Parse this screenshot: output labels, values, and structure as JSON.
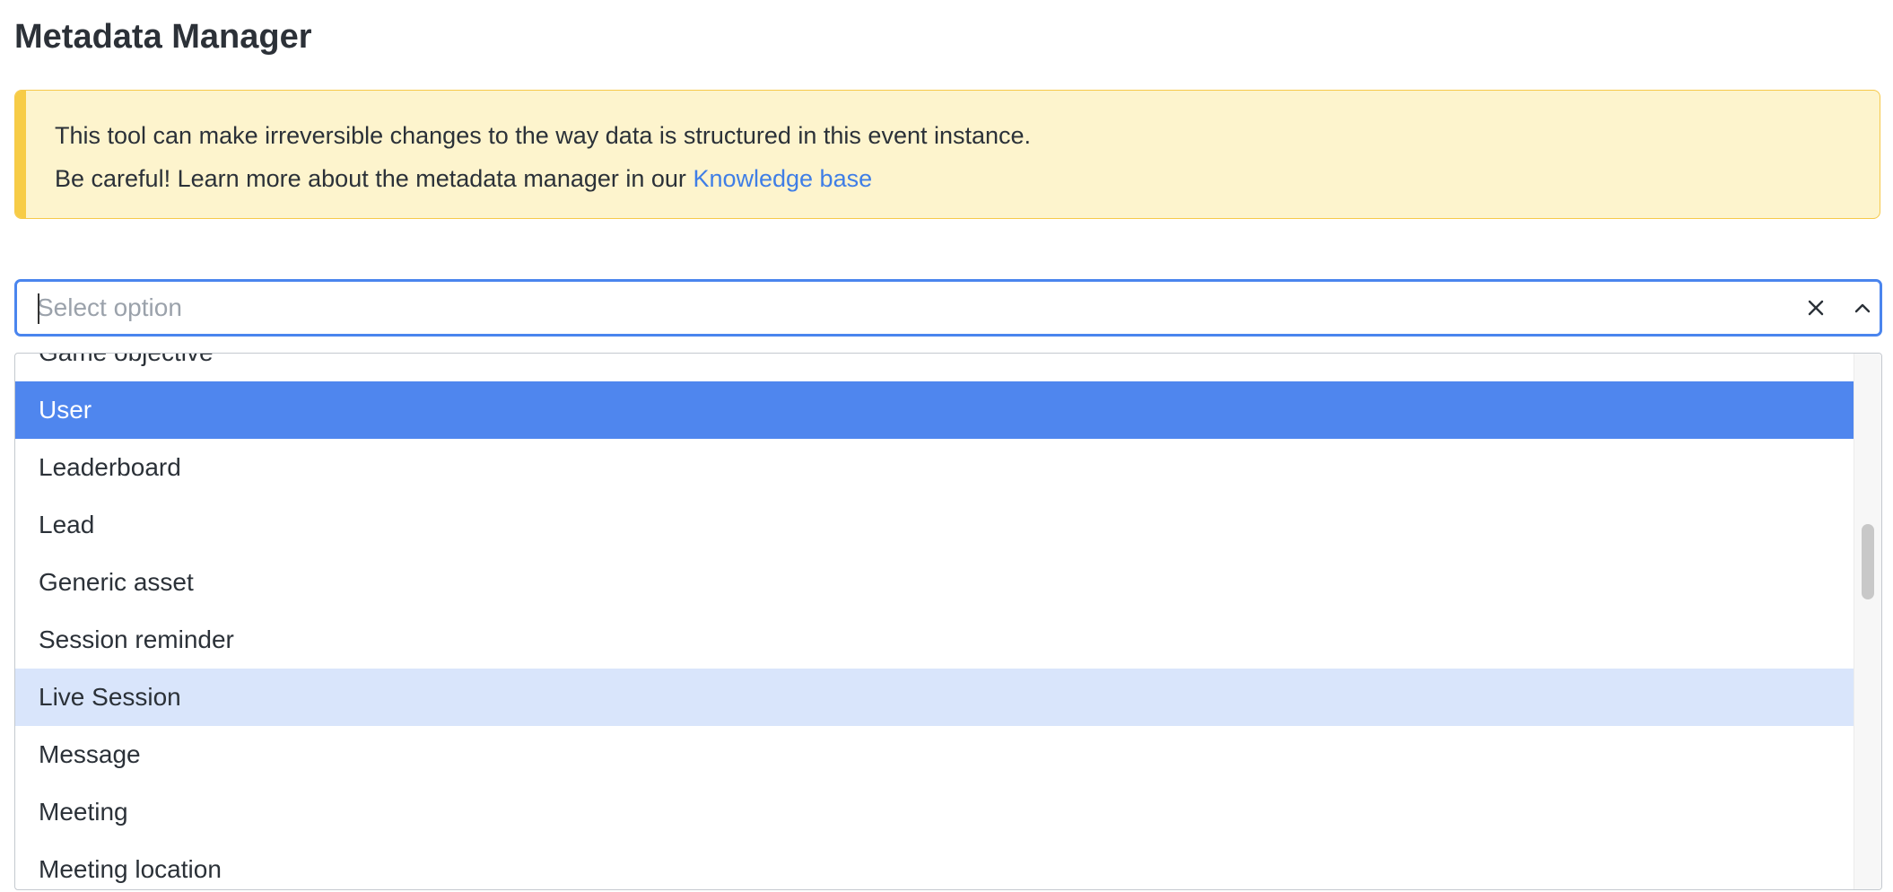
{
  "page": {
    "title": "Metadata Manager"
  },
  "alert": {
    "line1": "This tool can make irreversible changes to the way data is structured in this event instance.",
    "line2_prefix": "Be careful! Learn more about the metadata manager in our",
    "link_text": "Knowledge base"
  },
  "select": {
    "placeholder": "Select option",
    "value": "",
    "clear_icon": "close-icon",
    "toggle_icon": "chevron-up-icon"
  },
  "dropdown": {
    "options": [
      {
        "label": "Game objective",
        "state": "normal"
      },
      {
        "label": "User",
        "state": "selected"
      },
      {
        "label": "Leaderboard",
        "state": "normal"
      },
      {
        "label": "Lead",
        "state": "normal"
      },
      {
        "label": "Generic asset",
        "state": "normal"
      },
      {
        "label": "Session reminder",
        "state": "normal"
      },
      {
        "label": "Live Session",
        "state": "hover"
      },
      {
        "label": "Message",
        "state": "normal"
      },
      {
        "label": "Meeting",
        "state": "normal"
      },
      {
        "label": "Meeting location",
        "state": "normal"
      }
    ]
  },
  "colors": {
    "accent": "#4f86ee",
    "hover": "#d9e5fb",
    "alert_bg": "#fdf4cd",
    "alert_border": "#f6c94a",
    "link": "#3f7ee6"
  }
}
